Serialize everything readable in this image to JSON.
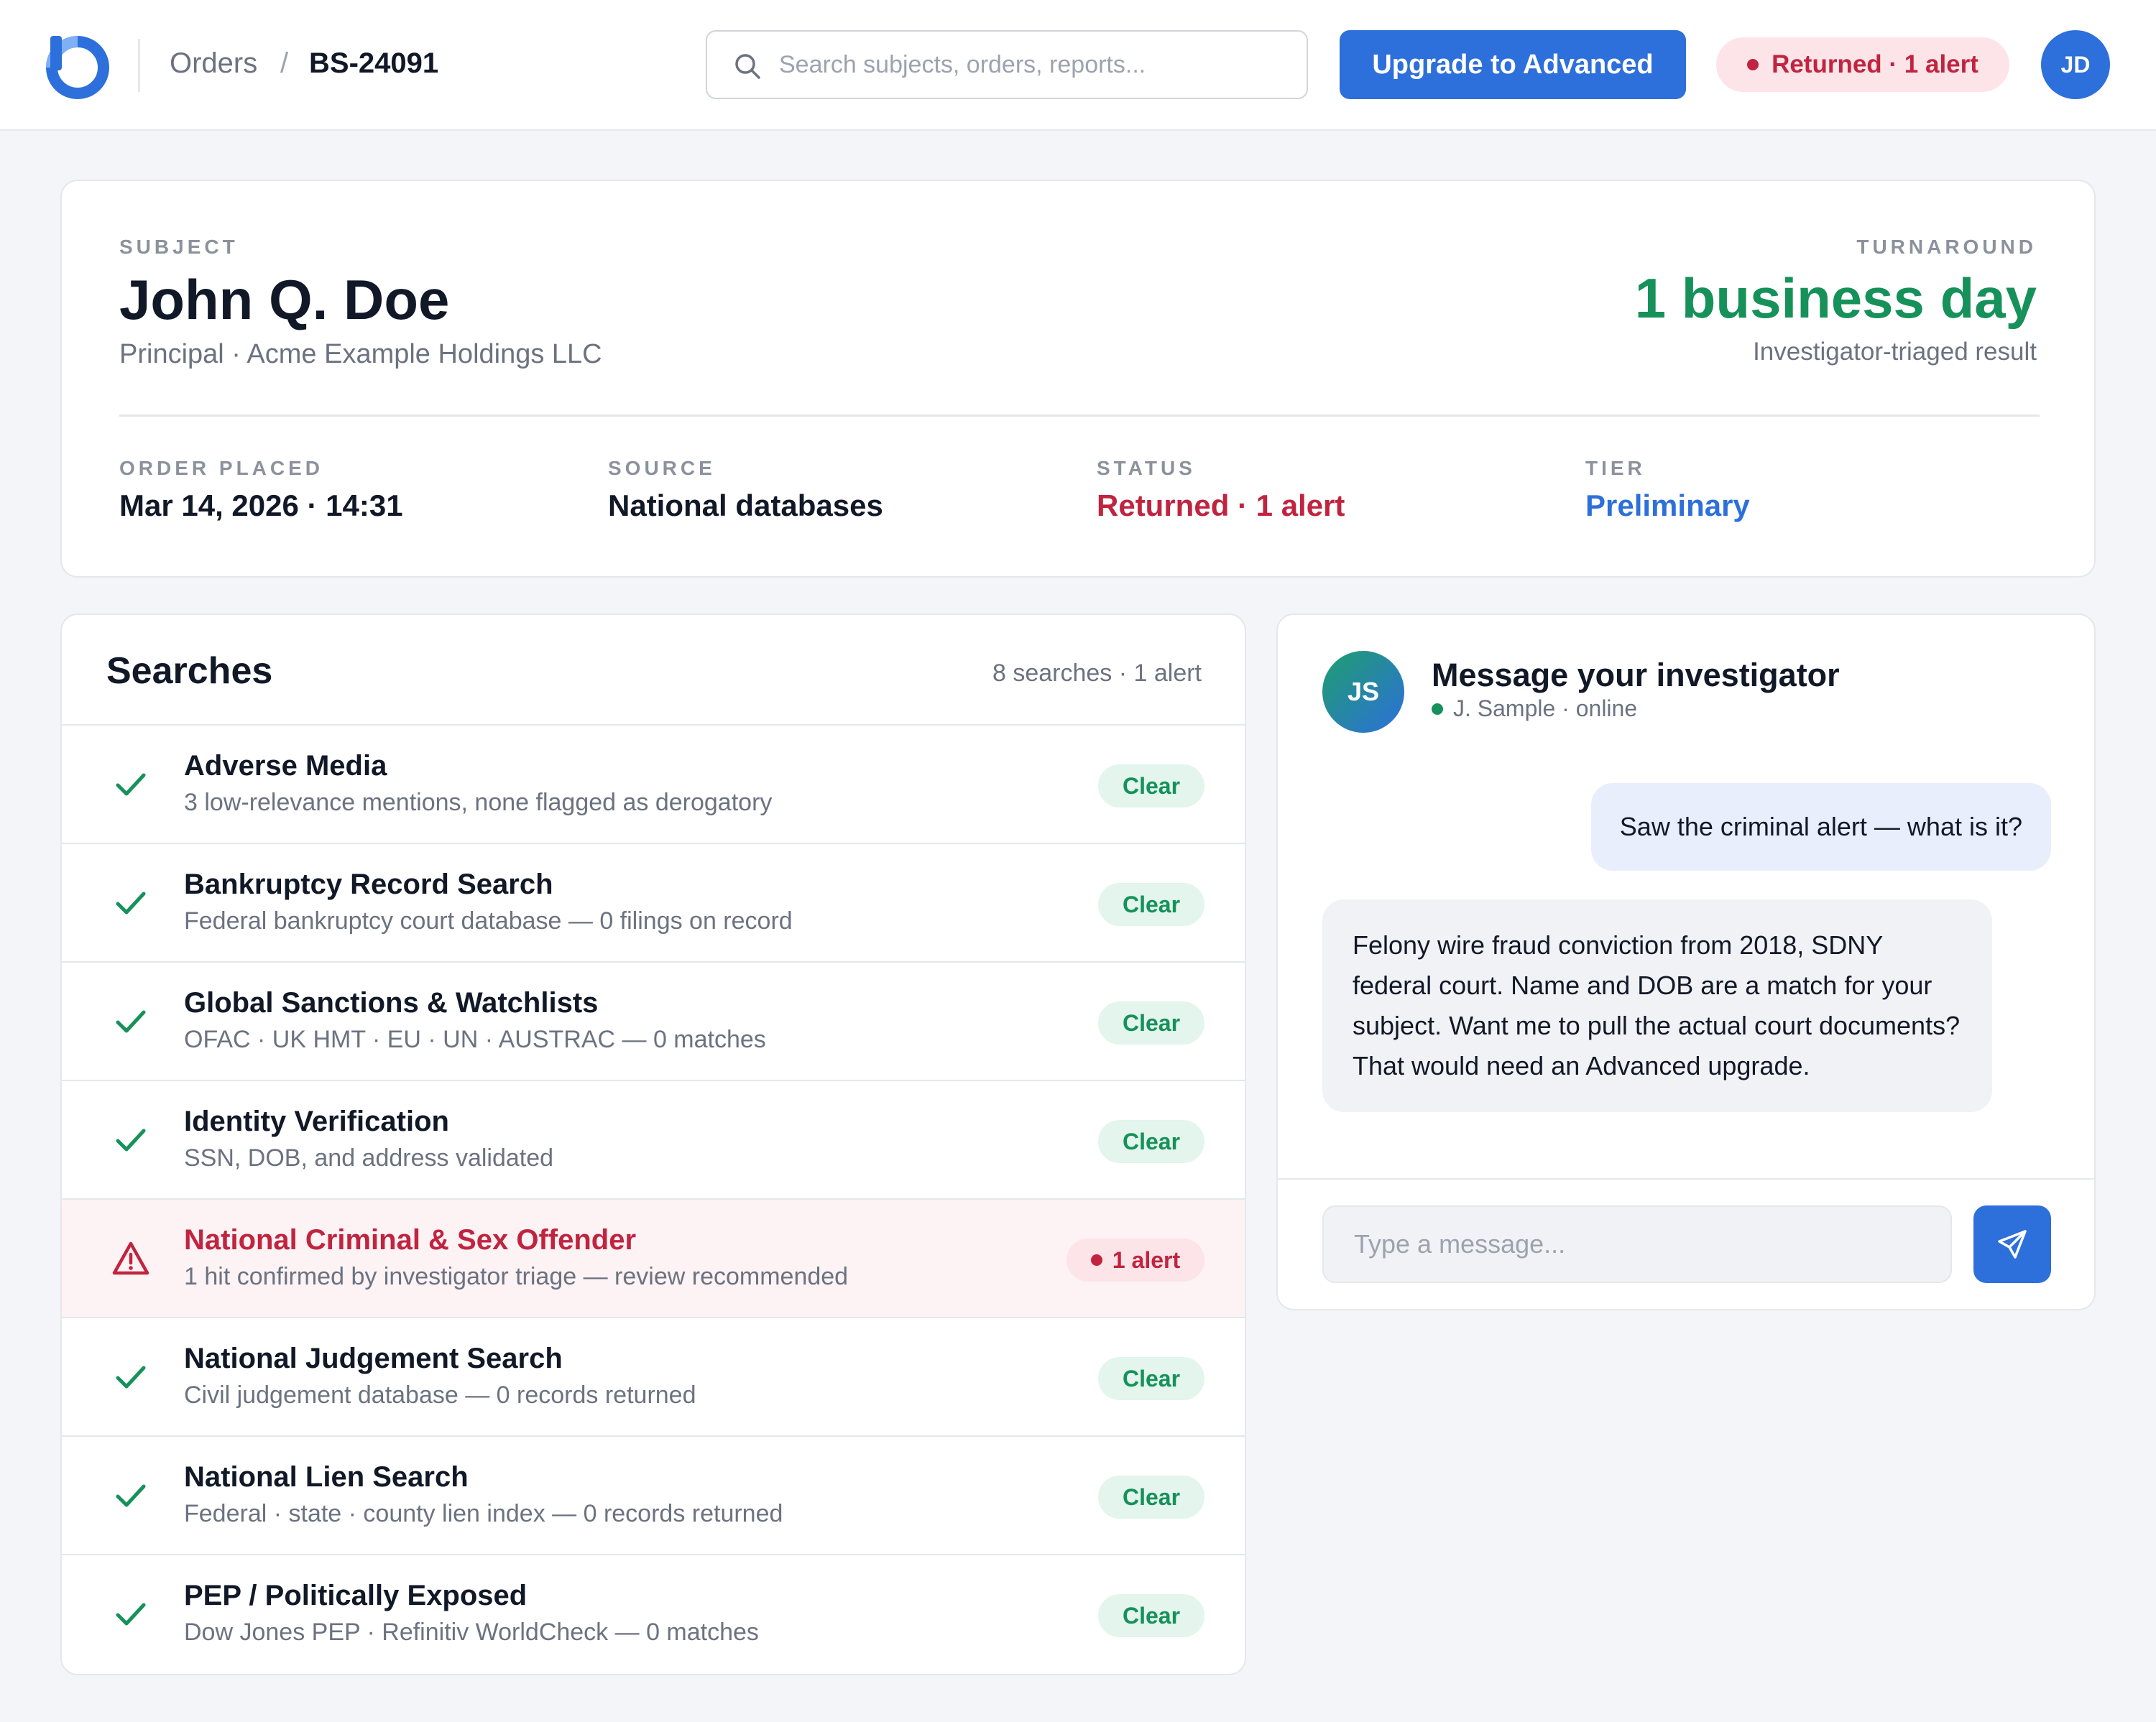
{
  "header": {
    "breadcrumb_orders": "Orders",
    "breadcrumb_separator": "/",
    "order_id": "BS-24091",
    "search_placeholder": "Search subjects, orders, reports...",
    "upgrade_label": "Upgrade to Advanced",
    "status_label": "Returned · 1 alert",
    "user_initials": "JD"
  },
  "subject": {
    "eyebrow": "SUBJECT",
    "name": "John Q. Doe",
    "role": "Principal · Acme Example Holdings LLC",
    "turnaround_eyebrow": "TURNAROUND",
    "turnaround_value": "1 business day",
    "turnaround_sub": "Investigator-triaged result",
    "meta": [
      {
        "label": "ORDER PLACED",
        "value": "Mar 14, 2026 · 14:31"
      },
      {
        "label": "SOURCE",
        "value": "National databases"
      },
      {
        "label": "STATUS",
        "value": "Returned · 1 alert"
      },
      {
        "label": "TIER",
        "value": "Preliminary"
      }
    ]
  },
  "searches": {
    "title": "Searches",
    "summary": "8 searches · 1 alert",
    "items": [
      {
        "title": "Adverse Media",
        "detail": "3 low-relevance mentions, none flagged as derogatory",
        "status": "Clear"
      },
      {
        "title": "Bankruptcy Record Search",
        "detail": "Federal bankruptcy court database — 0 filings on record",
        "status": "Clear"
      },
      {
        "title": "Global Sanctions & Watchlists",
        "detail": "OFAC · UK HMT · EU · UN · AUSTRAC — 0 matches",
        "status": "Clear"
      },
      {
        "title": "Identity Verification",
        "detail": "SSN, DOB, and address validated",
        "status": "Clear"
      },
      {
        "title": "National Criminal & Sex Offender",
        "detail": "1 hit confirmed by investigator triage — review recommended",
        "status": "1 alert"
      },
      {
        "title": "National Judgement Search",
        "detail": "Civil judgement database — 0 records returned",
        "status": "Clear"
      },
      {
        "title": "National Lien Search",
        "detail": "Federal · state · county lien index — 0 records returned",
        "status": "Clear"
      },
      {
        "title": "PEP / Politically Exposed",
        "detail": "Dow Jones PEP · Refinitiv WorldCheck — 0 matches",
        "status": "Clear"
      }
    ]
  },
  "chat": {
    "avatar_initials": "JS",
    "title": "Message your investigator",
    "presence": "J. Sample · online",
    "messages": [
      {
        "from": "user",
        "text": "Saw the criminal alert — what is it?"
      },
      {
        "from": "investigator",
        "text": "Felony wire fraud conviction from 2018, SDNY federal court. Name and DOB are a match for your subject. Want me to pull the actual court documents? That would need an Advanced upgrade."
      }
    ],
    "input_placeholder": "Type a message..."
  },
  "colors": {
    "brand": "#2d6fdb",
    "success": "#16915a",
    "alert": "#c0243f"
  },
  "icons": {
    "row_clear": "checkmark-icon",
    "row_alert": "warning-triangle-icon",
    "search": "search-icon",
    "send": "send-icon"
  }
}
